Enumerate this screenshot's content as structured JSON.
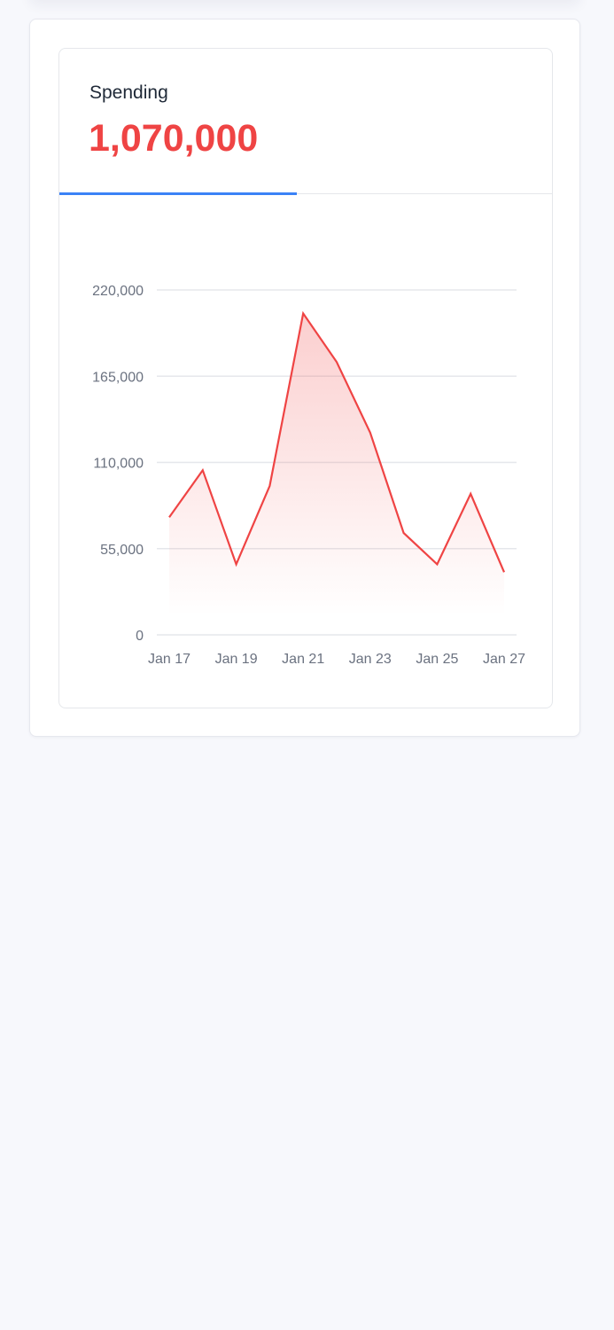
{
  "spending_card": {
    "label": "Spending",
    "value": "1,070,000"
  },
  "colors": {
    "accent": "#3b82f6",
    "line": "#ef4444",
    "value_text": "#ef4444"
  },
  "chart_data": {
    "type": "area",
    "title": "",
    "xlabel": "",
    "ylabel": "",
    "x": [
      "Jan 17",
      "Jan 18",
      "Jan 19",
      "Jan 20",
      "Jan 21",
      "Jan 22",
      "Jan 23",
      "Jan 24",
      "Jan 25",
      "Jan 26",
      "Jan 27"
    ],
    "values": [
      75000,
      105000,
      45000,
      95000,
      205000,
      174000,
      129000,
      65000,
      45000,
      90000,
      40000
    ],
    "ylim": [
      0,
      220000
    ],
    "y_ticks": [
      0,
      55000,
      110000,
      165000,
      220000
    ],
    "y_tick_labels": [
      "0",
      "55,000",
      "110,000",
      "165,000",
      "220,000"
    ],
    "x_tick_labels": [
      "Jan 17",
      "Jan 19",
      "Jan 21",
      "Jan 23",
      "Jan 25",
      "Jan 27"
    ],
    "grid": true,
    "legend": "none"
  }
}
